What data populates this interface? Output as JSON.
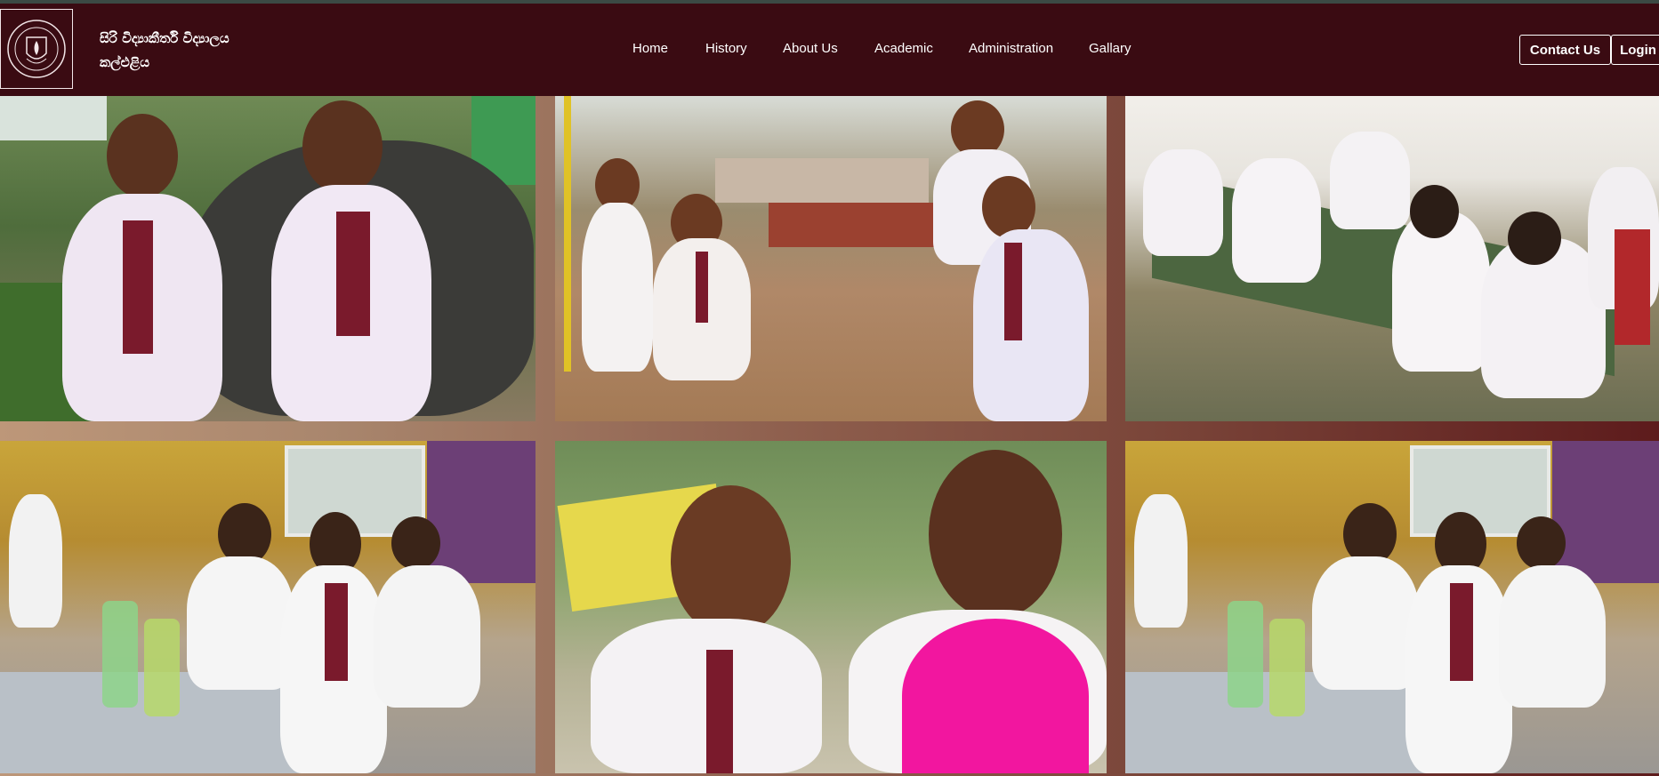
{
  "header": {
    "logo_icon": "school-crest-icon",
    "school_name_line1": "සිරි විද්‍යාකීර්ති විද්‍යාලය",
    "school_name_line2": "කල්එළිය"
  },
  "nav": {
    "items": [
      {
        "label": "Home"
      },
      {
        "label": "History"
      },
      {
        "label": "About Us"
      },
      {
        "label": "Academic"
      },
      {
        "label": "Administration"
      },
      {
        "label": "Gallary"
      }
    ],
    "contact_label": "Contact Us",
    "login_label": "Login"
  },
  "gallery": {
    "photos": [
      {
        "subject": "two girls in uniform beside chalkboard stone"
      },
      {
        "subject": "children on swings"
      },
      {
        "subject": "students writing at outdoor desks"
      },
      {
        "subject": "students in classroom"
      },
      {
        "subject": "two smiling boys"
      },
      {
        "subject": "students in classroom"
      }
    ]
  },
  "colors": {
    "header_bg": "#3a0b12",
    "tie": "#7a1a2c",
    "uniform": "#f4f0f6"
  }
}
